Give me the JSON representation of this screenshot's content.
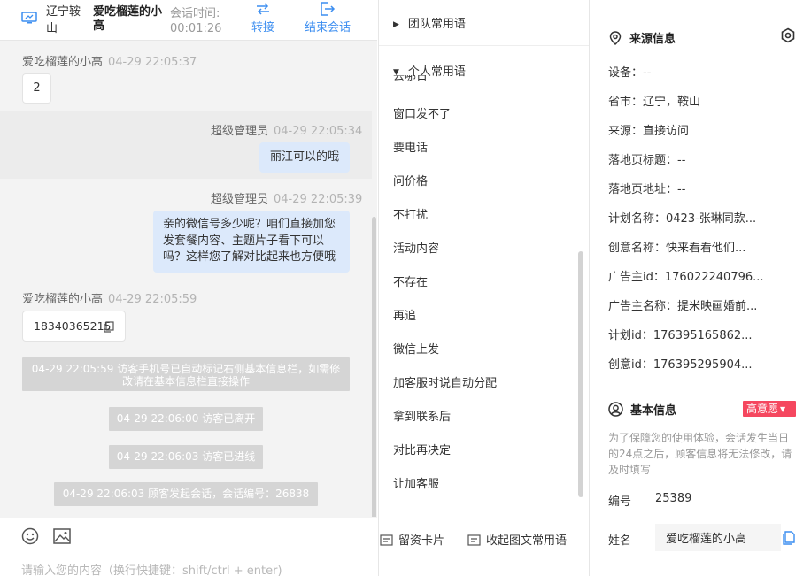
{
  "header": {
    "location": "辽宁鞍山",
    "visitor_name": "爱吃榴莲的小高",
    "session_time_label": "会话时间:",
    "session_time": "00:01:26",
    "transfer_label": "转接",
    "end_label": "结束会话"
  },
  "messages": [
    {
      "sender": "爱吃榴莲的小高",
      "time": "04-29 22:05:37",
      "text": "2"
    },
    {
      "sender": "超级管理员",
      "time": "04-29 22:05:34",
      "text": "丽江可以的哦"
    },
    {
      "sender": "超级管理员",
      "time": "04-29 22:05:39",
      "text": "亲的微信号多少呢？咱们直接加您发套餐内容、主题片子看下可以吗？这样您了解对比起来也方便哦"
    },
    {
      "sender": "爱吃榴莲的小高",
      "time": "04-29 22:05:59",
      "text": "18340365215"
    }
  ],
  "system_messages": [
    "04-29 22:05:59 访客手机号已自动标记右侧基本信息栏，如需修改请在基本信息栏直接操作",
    "04-29 22:06:00 访客已离开",
    "04-29 22:06:03 访客已进线",
    "04-29 22:06:03 顾客发起会话，会话编号：26838"
  ],
  "input": {
    "placeholder": "请输入您的内容（换行快捷键：shift/ctrl + enter)"
  },
  "phrases": {
    "team_group": "团队常用语",
    "personal_group": "个人常用语",
    "clipped_item": "去哪日",
    "items": [
      "窗口发不了",
      "要电话",
      "问价格",
      "不打扰",
      "活动内容",
      "不存在",
      "再追",
      "微信上发",
      "加客服时说自动分配",
      "拿到联系后",
      "对比再决定",
      "让加客服"
    ],
    "footer_card": "留资卡片",
    "footer_collapse": "收起图文常用语"
  },
  "source_info": {
    "title": "来源信息",
    "rows": [
      {
        "label": "设备：",
        "value": "--"
      },
      {
        "label": "省市：",
        "value": "辽宁，鞍山"
      },
      {
        "label": "来源：",
        "value": "直接访问"
      },
      {
        "label": "落地页标题：",
        "value": "--"
      },
      {
        "label": "落地页地址：",
        "value": "--"
      },
      {
        "label": "计划名称：",
        "value": "0423-张琳同款..."
      },
      {
        "label": "创意名称：",
        "value": "快来看看他们..."
      },
      {
        "label": "广告主id：",
        "value": "176022240796..."
      },
      {
        "label": "广告主名称：",
        "value": "提米映画婚前..."
      },
      {
        "label": "计划id：",
        "value": "176395165862..."
      },
      {
        "label": "创意id：",
        "value": "176395295904..."
      }
    ]
  },
  "basic_info": {
    "title": "基本信息",
    "intent_badge": "高意愿",
    "note": "为了保障您的使用体验，会话发生当日的24点之后，顾客信息将无法修改，请及时填写",
    "number_label": "编号",
    "number_value": "25389",
    "name_label": "姓名",
    "name_value": "爱吃榴莲的小高"
  },
  "colors": {
    "accent": "#3c8ef0",
    "badge_red": "#f5475f",
    "agent_bubble": "#dce9fb",
    "system_bg": "#d5d5d5"
  }
}
